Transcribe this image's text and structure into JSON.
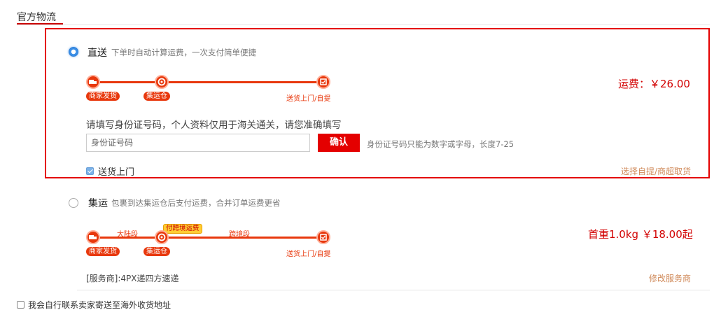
{
  "section": {
    "title": "官方物流"
  },
  "direct": {
    "label": "直送",
    "desc": "下单时自动计算运费，一次支付简单便捷",
    "selected": true,
    "timeline": {
      "start": "商家发货",
      "middle": "集运仓",
      "end": "送货上门/自提"
    },
    "price": "运费：￥26.00",
    "id_prompt": "请填写身份证号码，个人资料仅用于海关通关，请您准确填写",
    "id_placeholder": "身份证号码",
    "confirm_label": "确认",
    "id_hint": "身份证号码只能为数字或字母，长度7-25",
    "door_delivery_label": "送货上门",
    "door_delivery_checked": true,
    "pickup_link": "选择自提/商超取货"
  },
  "consolidated": {
    "label": "集运",
    "desc": "包裹到达集运仓后支付运费，合并订单运费更省",
    "selected": false,
    "timeline": {
      "start": "商家发货",
      "middle": "集运仓",
      "end": "送货上门/自提",
      "segment1": "大陆段",
      "bubble": "付跨境运费",
      "segment2": "跨境段"
    },
    "price": "首重1.0kg ￥18.00起",
    "carrier": "[服务商]:4PX递四方速递",
    "change_carrier_link": "修改服务商"
  },
  "self_ship": {
    "label": "我会自行联系卖家寄送至海外收货地址",
    "checked": false
  },
  "colors": {
    "accent_red": "#e40000",
    "track_orange": "#e8380d",
    "link_tan": "#d08a5a",
    "radio_blue": "#3a8ee6"
  },
  "icons": [
    "truck-icon",
    "warehouse-icon",
    "delivery-box-icon"
  ]
}
